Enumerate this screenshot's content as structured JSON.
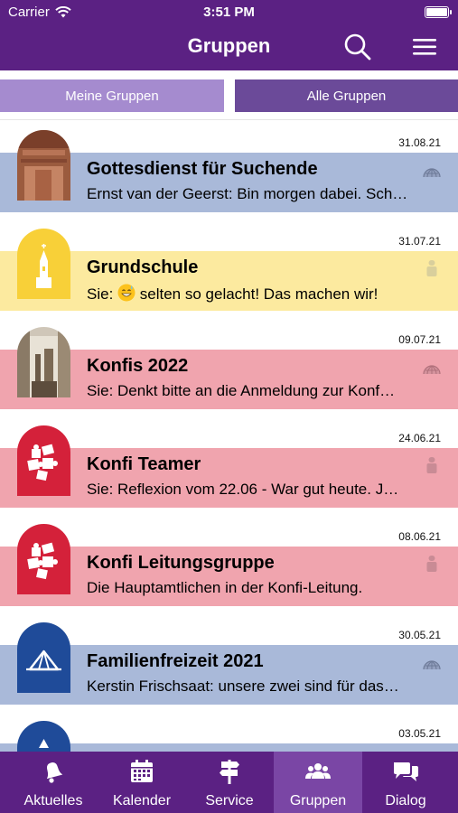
{
  "status_bar": {
    "carrier": "Carrier",
    "time": "3:51 PM",
    "battery_level": 1.0
  },
  "header": {
    "title": "Gruppen",
    "search_icon": "search-icon",
    "menu_icon": "hamburger-menu-icon"
  },
  "tabs": {
    "mine": "Meine Gruppen",
    "all": "Alle Gruppen",
    "selected": "all"
  },
  "colors": {
    "brand": "#5b2183",
    "tab_mine": "#a58bcf",
    "tab_all": "#6b4a99",
    "band_blue": "#a9b9d9",
    "band_yellow": "#fcea9f",
    "band_red": "#f0a4ae",
    "badge_red": "#d4213a",
    "badge_yellow": "#f8d038",
    "badge_blue": "#1f4b99"
  },
  "groups": [
    {
      "name": "Gottesdienst für Suchende",
      "message": "Ernst van der Geerst: Bin morgen dabei. Sch…",
      "date": "31.08.21",
      "type_icon": "globe-icon",
      "avatar": "photo-brick-wall"
    },
    {
      "name": "Grundschule",
      "message_prefix": "Sie:",
      "message": "selten so gelacht! Das machen wir!",
      "date": "31.07.21",
      "type_icon": "person-icon",
      "avatar": "church-icon",
      "emoji": "grinning-sweat-emoji"
    },
    {
      "name": "Konfis 2022",
      "message": "Sie: Denkt bitte an die Anmeldung zur Konf…",
      "date": "09.07.21",
      "type_icon": "globe-icon",
      "avatar": "photo-doorway"
    },
    {
      "name": "Konfi Teamer",
      "message": "Sie: Reflexion vom 22.06 - War gut heute. J…",
      "date": "24.06.21",
      "type_icon": "person-icon",
      "avatar": "puzzle-icon"
    },
    {
      "name": "Konfi Leitungsgruppe",
      "message": "Die Hauptamtlichen in der Konfi-Leitung.",
      "date": "08.06.21",
      "type_icon": "person-icon",
      "avatar": "puzzle-icon"
    },
    {
      "name": "Familienfreizeit 2021",
      "message": "Kerstin Frischsaat: unsere zwei sind für das…",
      "date": "30.05.21",
      "type_icon": "globe-icon",
      "avatar": "tent-icon"
    },
    {
      "name": "",
      "message": "",
      "date": "03.05.21",
      "type_icon": "",
      "avatar": "tent-icon"
    }
  ],
  "tabbar": [
    {
      "label": "Aktuelles",
      "icon": "bell-icon"
    },
    {
      "label": "Kalender",
      "icon": "calendar-icon"
    },
    {
      "label": "Service",
      "icon": "signpost-icon"
    },
    {
      "label": "Gruppen",
      "icon": "people-icon",
      "active": true
    },
    {
      "label": "Dialog",
      "icon": "chat-bubbles-icon"
    }
  ]
}
